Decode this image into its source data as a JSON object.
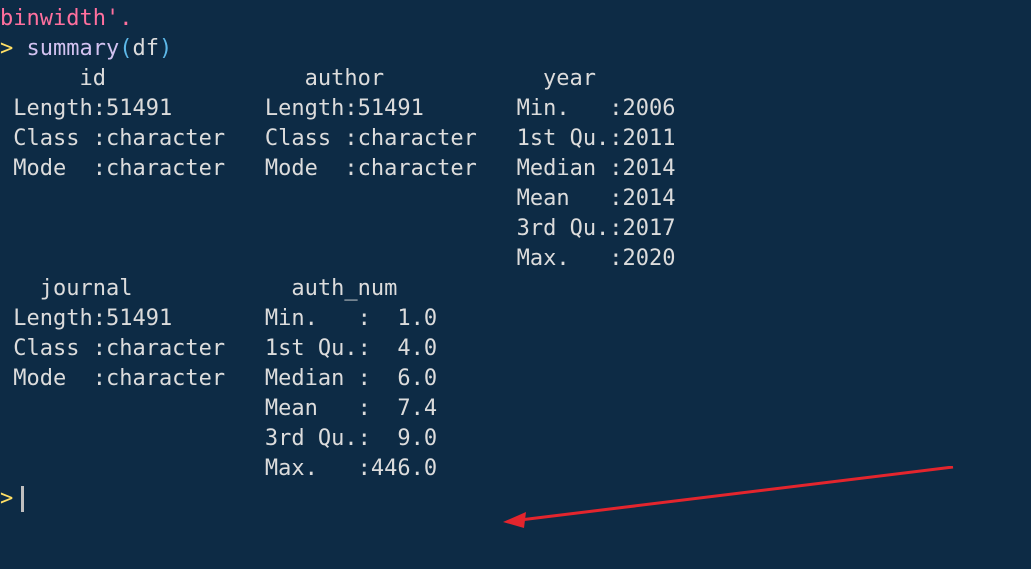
{
  "top_partial": {
    "text": "binwidth'."
  },
  "input": {
    "prompt": ">",
    "fn": "summary",
    "open": "(",
    "arg": "df",
    "close": ")"
  },
  "headers_row1": "      id               author            year     ",
  "summary": {
    "block1": {
      "id": {
        "length": " Length:51491      ",
        "class": " Class :character  ",
        "mode": " Mode  :character  ",
        "blank4": "                   ",
        "blank5": "                   ",
        "blank6": "                   "
      },
      "author": {
        "length": " Length:51491      ",
        "class": " Class :character  ",
        "mode": " Mode  :character  ",
        "blank4": "                   ",
        "blank5": "                   ",
        "blank6": "                   "
      },
      "year": {
        "min": " Min.   :2006  ",
        "q1": " 1st Qu.:2011  ",
        "median": " Median :2014  ",
        "mean": " Mean   :2014  ",
        "q3": " 3rd Qu.:2017  ",
        "max": " Max.   :2020  "
      }
    },
    "headers_row2": "   journal            auth_num    ",
    "block2": {
      "journal": {
        "length": " Length:51491      ",
        "class": " Class :character  ",
        "mode": " Mode  :character  ",
        "blank4": "                   ",
        "blank5": "                   ",
        "blank6": "                   "
      },
      "auth_num": {
        "min": " Min.   :  1.0  ",
        "q1": " 1st Qu.:  4.0  ",
        "median": " Median :  6.0  ",
        "mean": " Mean   :  7.4  ",
        "q3": " 3rd Qu.:  9.0  ",
        "max": " Max.   :446.0  "
      }
    }
  },
  "bottom_prompt": ">"
}
